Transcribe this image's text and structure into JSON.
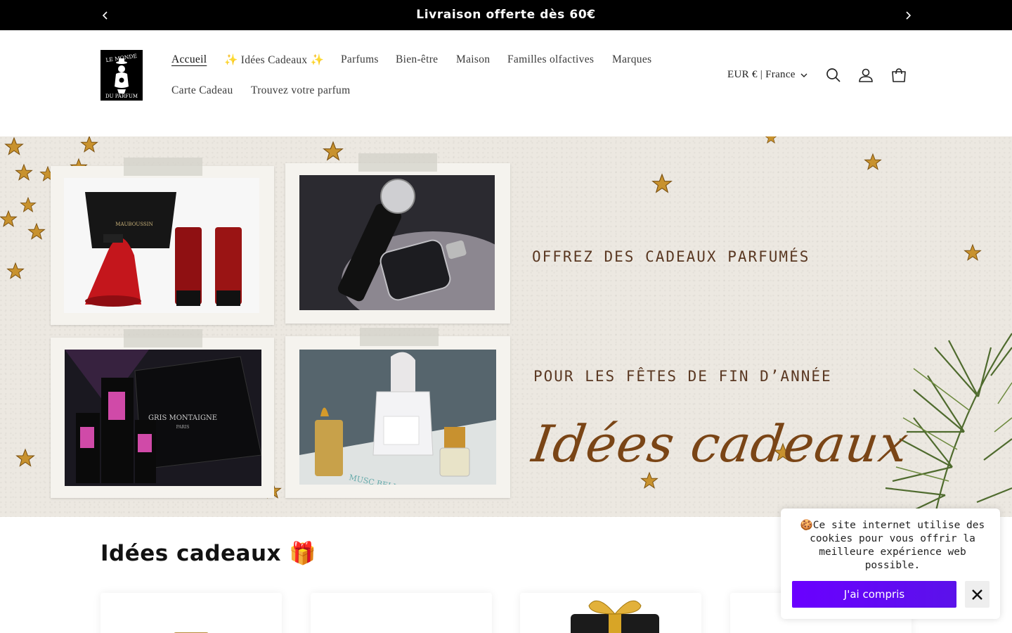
{
  "announcement": {
    "text": "Livraison offerte dès 60€",
    "prev_icon": "chevron-left-icon",
    "next_icon": "chevron-right-icon"
  },
  "header": {
    "logo_text": [
      "LE MONDE",
      "DU PARFUM"
    ],
    "nav": [
      {
        "label": "Accueil",
        "active": true
      },
      {
        "label": "✨ Idées Cadeaux ✨",
        "active": false
      },
      {
        "label": "Parfums",
        "active": false
      },
      {
        "label": "Bien-être",
        "active": false
      },
      {
        "label": "Maison",
        "active": false
      },
      {
        "label": "Familles olfactives",
        "active": false
      },
      {
        "label": "Marques",
        "active": false
      },
      {
        "label": "Carte Cadeau",
        "active": false
      },
      {
        "label": "Trouvez votre parfum",
        "active": false
      }
    ],
    "locale": "EUR € | France",
    "icons": [
      "search-icon",
      "account-icon",
      "cart-icon"
    ]
  },
  "hero": {
    "kicker": "OFFREZ DES CADEAUX PARFUMÉS",
    "title": "Idées cadeaux",
    "subtitle": "POUR LES FÊTES DE FIN D’ANNÉE",
    "photos": [
      {
        "product_text": "MAUBOUSSIN"
      },
      {
        "product_text": ""
      },
      {
        "product_text": "GRIS MONTAIGNE",
        "product_subtext": "PARIS"
      },
      {
        "product_text": "MUSC BELLA"
      }
    ]
  },
  "section": {
    "title": "Idées cadeaux 🎁"
  },
  "cookie": {
    "text": "🍪Ce site internet utilise des cookies pour vous offrir la meilleure expérience web possible.",
    "accept_label": "J'ai compris"
  },
  "colors": {
    "announcement_bg": "#000000",
    "hero_text": "#7a4516",
    "cookie_button": "#5b12ea"
  }
}
